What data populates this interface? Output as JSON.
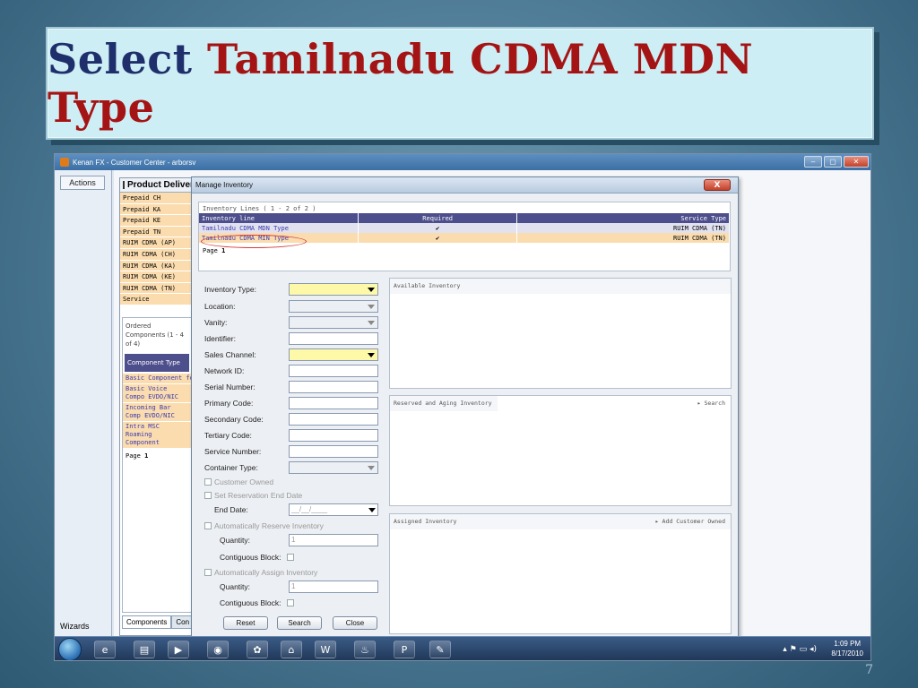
{
  "slide": {
    "title_part1": "Select",
    "title_part2": "Tamilnadu CDMA MDN Type",
    "page_number": "7",
    "title_colors": {
      "part1": "#1f2f6b",
      "part2": "#a51414"
    }
  },
  "app": {
    "window_title": "Kenan FX - Customer Center - arborsv",
    "window_buttons": [
      "–",
      "▢",
      "✕"
    ],
    "left_tabs": {
      "actions": "Actions",
      "wizards": "Wizards"
    }
  },
  "product_delivery": {
    "header": "Product Delivery",
    "items": [
      "Prepaid CH",
      "Prepaid KA",
      "Prepaid KE",
      "Prepaid TN",
      "RUIM CDMA (AP)",
      "RUIM CDMA (CH)",
      "RUIM CDMA (KA)",
      "RUIM CDMA (KE)",
      "RUIM CDMA (TN)",
      "Service"
    ],
    "ordered_components": {
      "title": "Ordered Components (1 - 4 of 4)",
      "column": "Component Type",
      "rows": [
        "Basic Component fo",
        "Basic Voice Compo EVDO/NIC",
        "Incoming Bar Comp EVDO/NIC",
        "Intra MSC Roaming Component"
      ],
      "page_label": "Page",
      "page_value": "1"
    },
    "tabs": [
      "Components",
      "Con"
    ]
  },
  "dialog": {
    "title": "Manage Inventory",
    "close": "X",
    "inventory_lines": {
      "caption": "Inventory Lines ( 1 - 2 of 2 )",
      "columns": [
        "Inventory line",
        "Required",
        "Service Type"
      ],
      "rows": [
        {
          "line": "Tamilnadu CDMA MDN Type",
          "required": "✔",
          "service_type": "RUIM CDMA (TN)"
        },
        {
          "line": "Tamilnadu CDMA MIN Type",
          "required": "✔",
          "service_type": "RUIM CDMA (TN)"
        }
      ],
      "page_label": "Page",
      "page_value": "1"
    },
    "form": {
      "inventory_type": "Inventory Type:",
      "location": "Location:",
      "vanity": "Vanity:",
      "identifier": "Identifier:",
      "sales_channel": "Sales Channel:",
      "network_id": "Network ID:",
      "serial_number": "Serial Number:",
      "primary_code": "Primary Code:",
      "secondary_code": "Secondary Code:",
      "tertiary_code": "Tertiary Code:",
      "service_number": "Service Number:",
      "container_type": "Container Type:",
      "customer_owned": "Customer Owned",
      "set_reservation": "Set Reservation End Date",
      "end_date": "End Date:",
      "end_date_value": "__/__/____",
      "auto_reserve": "Automatically Reserve Inventory",
      "quantity": "Quantity:",
      "quantity_value_1": "1",
      "contiguous": "Contiguous Block:",
      "auto_assign": "Automatically Assign Inventory",
      "quantity_value_2": "1"
    },
    "buttons": {
      "reset": "Reset",
      "search": "Search",
      "close": "Close"
    },
    "panels": {
      "available": "Available Inventory",
      "reserved": "Reserved and Aging Inventory",
      "reserved_action": "▸ Search",
      "assigned": "Assigned Inventory",
      "assigned_action": "▸ Add Customer Owned"
    }
  },
  "taskbar": {
    "time": "1:09 PM",
    "date": "8/17/2010",
    "icons": [
      "internet-explorer-icon",
      "folder-icon",
      "media-player-icon",
      "firefox-icon",
      "frog-icon",
      "network-icon",
      "word-icon",
      "java-icon",
      "powerpoint-icon",
      "paint-icon"
    ]
  }
}
